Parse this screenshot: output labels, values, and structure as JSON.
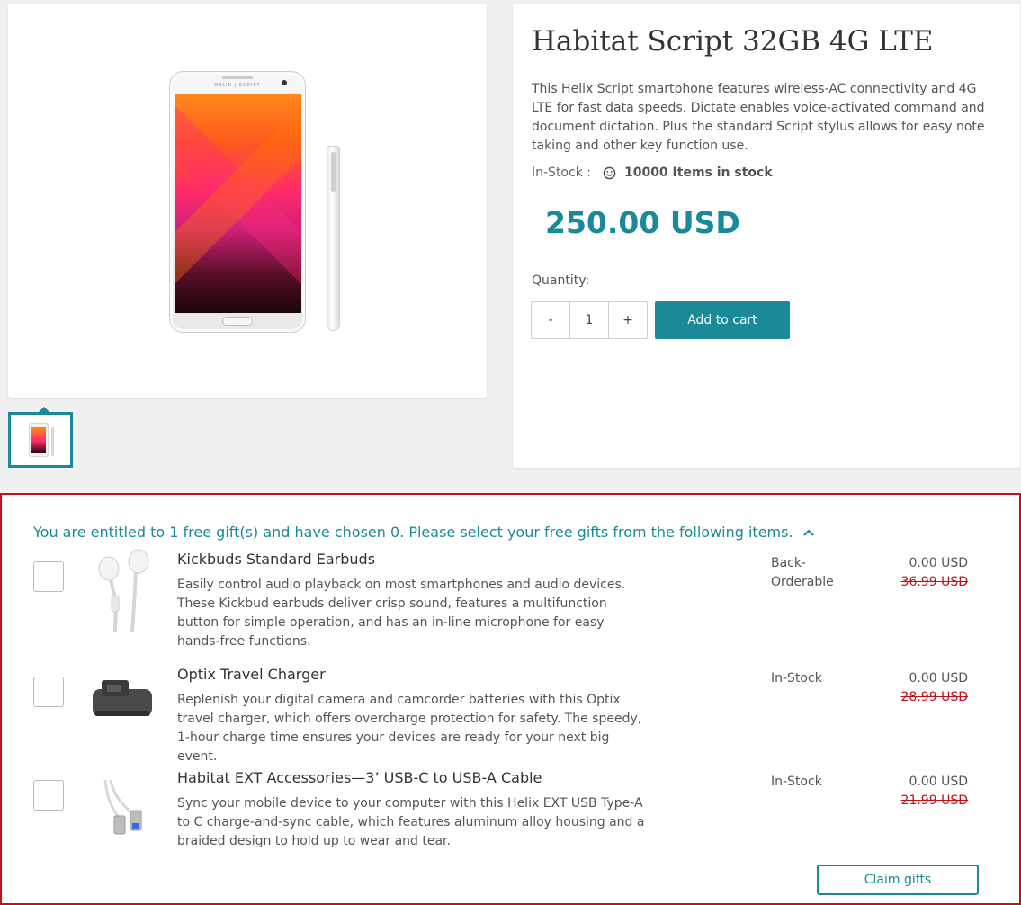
{
  "product": {
    "title": "Habitat Script 32GB 4G LTE",
    "description": "This Helix Script smartphone features wireless-AC connectivity and 4G LTE for fast data speeds. Dictate enables voice-activated command and document dictation. Plus the standard Script stylus allows for easy note taking and other key function use.",
    "image_brand": "HELIX | SCRIPT",
    "stock_label": "In-Stock :",
    "stock_icon": "smiley-icon",
    "stock_count": "10000 Items in stock",
    "price": "250.00 USD",
    "quantity_label": "Quantity:",
    "quantity_decrement": "-",
    "quantity_value": "1",
    "quantity_increment": "+",
    "add_to_cart_label": "Add to cart",
    "accent_color": "#1a8a98"
  },
  "gifts": {
    "header": "You are entitled to 1 free gift(s) and have chosen 0. Please select your free gifts from the following items.",
    "header_icon": "chevron-up-icon",
    "highlight_border_color": "#c0121a",
    "items": [
      {
        "name": "Kickbuds Standard Earbuds",
        "description": "Easily control audio playback on most smartphones and audio devices. These Kickbud earbuds deliver crisp sound, features a multifunction button for simple operation, and has an in-line microphone for easy hands-free functions.",
        "status": "Back-Orderable",
        "price": "0.00 USD",
        "original_price": "36.99 USD"
      },
      {
        "name": "Optix Travel Charger",
        "description": "Replenish your digital camera and camcorder batteries with this Optix travel charger, which offers overcharge protection for safety. The speedy, 1-hour charge time ensures your devices are ready for your next big event.",
        "status": "In-Stock",
        "price": "0.00 USD",
        "original_price": "28.99 USD"
      },
      {
        "name": "Habitat EXT Accessories—3’ USB-C to USB-A Cable",
        "description": "Sync your mobile device to your computer with this Helix EXT USB Type-A to C charge-and-sync cable, which features aluminum alloy housing and a braided design to hold up to wear and tear.",
        "status": "In-Stock",
        "price": "0.00 USD",
        "original_price": "21.99 USD"
      }
    ],
    "claim_label": "Claim gifts"
  }
}
